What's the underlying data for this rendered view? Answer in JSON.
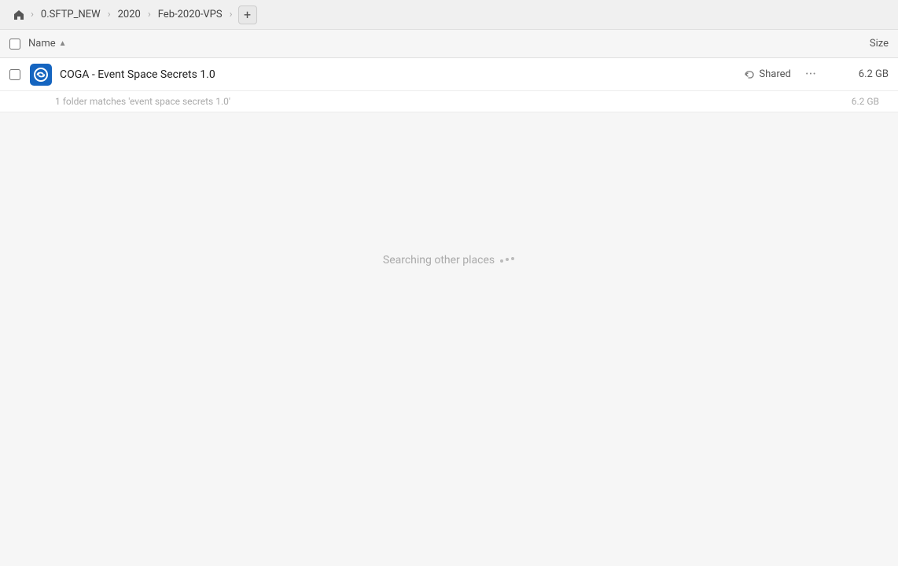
{
  "breadcrumb": {
    "home_icon": "🏠",
    "items": [
      {
        "label": "0.SFTP_NEW"
      },
      {
        "label": "2020"
      },
      {
        "label": "Feb-2020-VPS"
      }
    ],
    "add_label": "+"
  },
  "columns": {
    "name_label": "Name",
    "size_label": "Size"
  },
  "file_row": {
    "name": "COGA - Event Space Secrets 1.0",
    "shared_label": "Shared",
    "more_label": "···",
    "size": "6.2 GB"
  },
  "summary": {
    "text": "1 folder matches 'event space secrets 1.0'",
    "size": "6.2 GB"
  },
  "searching": {
    "text": "Searching other places",
    "dots": ".."
  }
}
